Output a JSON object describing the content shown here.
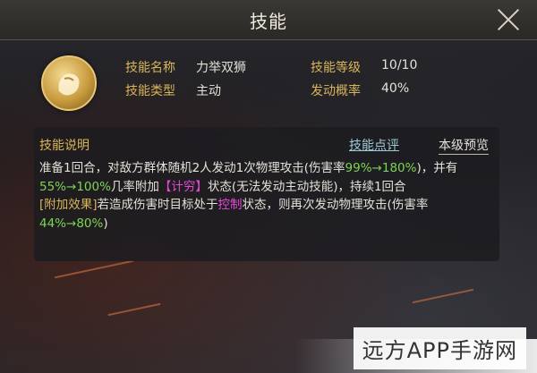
{
  "header": {
    "title": "技能"
  },
  "skill": {
    "name_label": "技能名称",
    "name_value": "力举双狮",
    "level_label": "技能等级",
    "level_value": "10/10",
    "type_label": "技能类型",
    "type_value": "主动",
    "chance_label": "发动概率",
    "chance_value": "40%"
  },
  "description": {
    "title": "技能说明",
    "review_link": "技能点评",
    "preview_link": "本级预览",
    "p1_a": "准备1回合，对敌方群体随机2人发动1次物理攻击(伤害率",
    "p1_dmg": "99%→180%",
    "p1_b": ")，并有",
    "p1_chance": "55%→100%",
    "p1_c": "几率附加",
    "p1_status": "【计穷】",
    "p1_d": "状态(无法发动主动技能)，持续1回合",
    "p2_label": "[附加效果]",
    "p2_a": "若造成伤害时目标处于",
    "p2_status": "控制",
    "p2_b": "状态，则再次发动物理攻击(伤害率",
    "p2_dmg": "44%→80%",
    "p2_c": ")"
  },
  "watermark": "远方APP手游网",
  "colors": {
    "gold": "#d9b45a",
    "green": "#7dd455",
    "magenta": "#e24bd8"
  }
}
